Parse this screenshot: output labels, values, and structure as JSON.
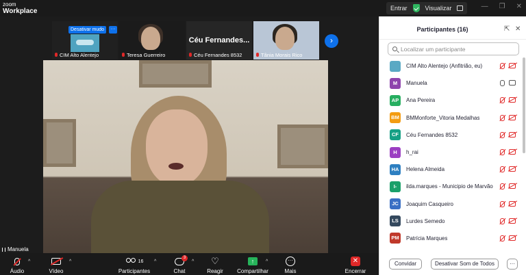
{
  "titlebar": {
    "brand_line1": "zoom",
    "brand_line2": "Workplace",
    "enter_label": "Entrar",
    "view_label": "Visualizar"
  },
  "thumbnails": [
    {
      "name": "CIM Alto Alentejo",
      "overlay_label": "Desativar mudo",
      "overlay_more": "···"
    },
    {
      "name": "Teresa Guerreiro"
    },
    {
      "name": "Céu Fernandes  8532",
      "big_text": "Céu  Fernandes..."
    },
    {
      "name": "Tânia Morais Rico"
    }
  ],
  "self_view": {
    "name": "Manuela"
  },
  "toolbar": {
    "audio_label": "Áudio",
    "video_label": "Vídeo",
    "participants_label": "Participantes",
    "participants_count": "16",
    "chat_label": "Chat",
    "chat_badge": "3",
    "react_label": "Reagir",
    "share_label": "Compartilhar",
    "more_label": "Mais",
    "end_label": "Encerrar"
  },
  "panel": {
    "title": "Participantes (16)",
    "search_placeholder": "Localizar um participante",
    "participants": [
      {
        "initials": "",
        "name": "CIM Alto Alentejo (Anfitrião, eu)",
        "color": "#5aa9c4",
        "mic": "muted",
        "cam": "off"
      },
      {
        "initials": "M",
        "name": "Manuela",
        "color": "#8e44ad",
        "mic": "on",
        "cam": "on"
      },
      {
        "initials": "AP",
        "name": "Ana Pereira",
        "color": "#27ae60",
        "mic": "muted",
        "cam": "off"
      },
      {
        "initials": "BM",
        "name": "BMMonforte_Vitoria Medalhas",
        "color": "#f39c12",
        "mic": "muted",
        "cam": "off"
      },
      {
        "initials": "CF",
        "name": "Céu Fernandes  8532",
        "color": "#16a085",
        "mic": "muted",
        "cam": "off"
      },
      {
        "initials": "H",
        "name": "h_rai",
        "color": "#9b3fc2",
        "mic": "muted",
        "cam": "off"
      },
      {
        "initials": "HA",
        "name": "Helena Almeida",
        "color": "#2d7fc1",
        "mic": "muted",
        "cam": "off"
      },
      {
        "initials": "I-",
        "name": "ilda.marques - Municipio de Marvão",
        "color": "#1aa06a",
        "mic": "muted",
        "cam": "off"
      },
      {
        "initials": "JC",
        "name": "Joaquim Casqueiro",
        "color": "#3a6fc4",
        "mic": "muted",
        "cam": "off"
      },
      {
        "initials": "LS",
        "name": "Lurdes Semedo",
        "color": "#34495e",
        "mic": "muted",
        "cam": "off"
      },
      {
        "initials": "PM",
        "name": "Patrícia Marques",
        "color": "#c0392b",
        "mic": "muted",
        "cam": "off"
      }
    ],
    "invite_label": "Convidar",
    "mute_all_label": "Desativar Som de Todos",
    "more_label": "···"
  }
}
